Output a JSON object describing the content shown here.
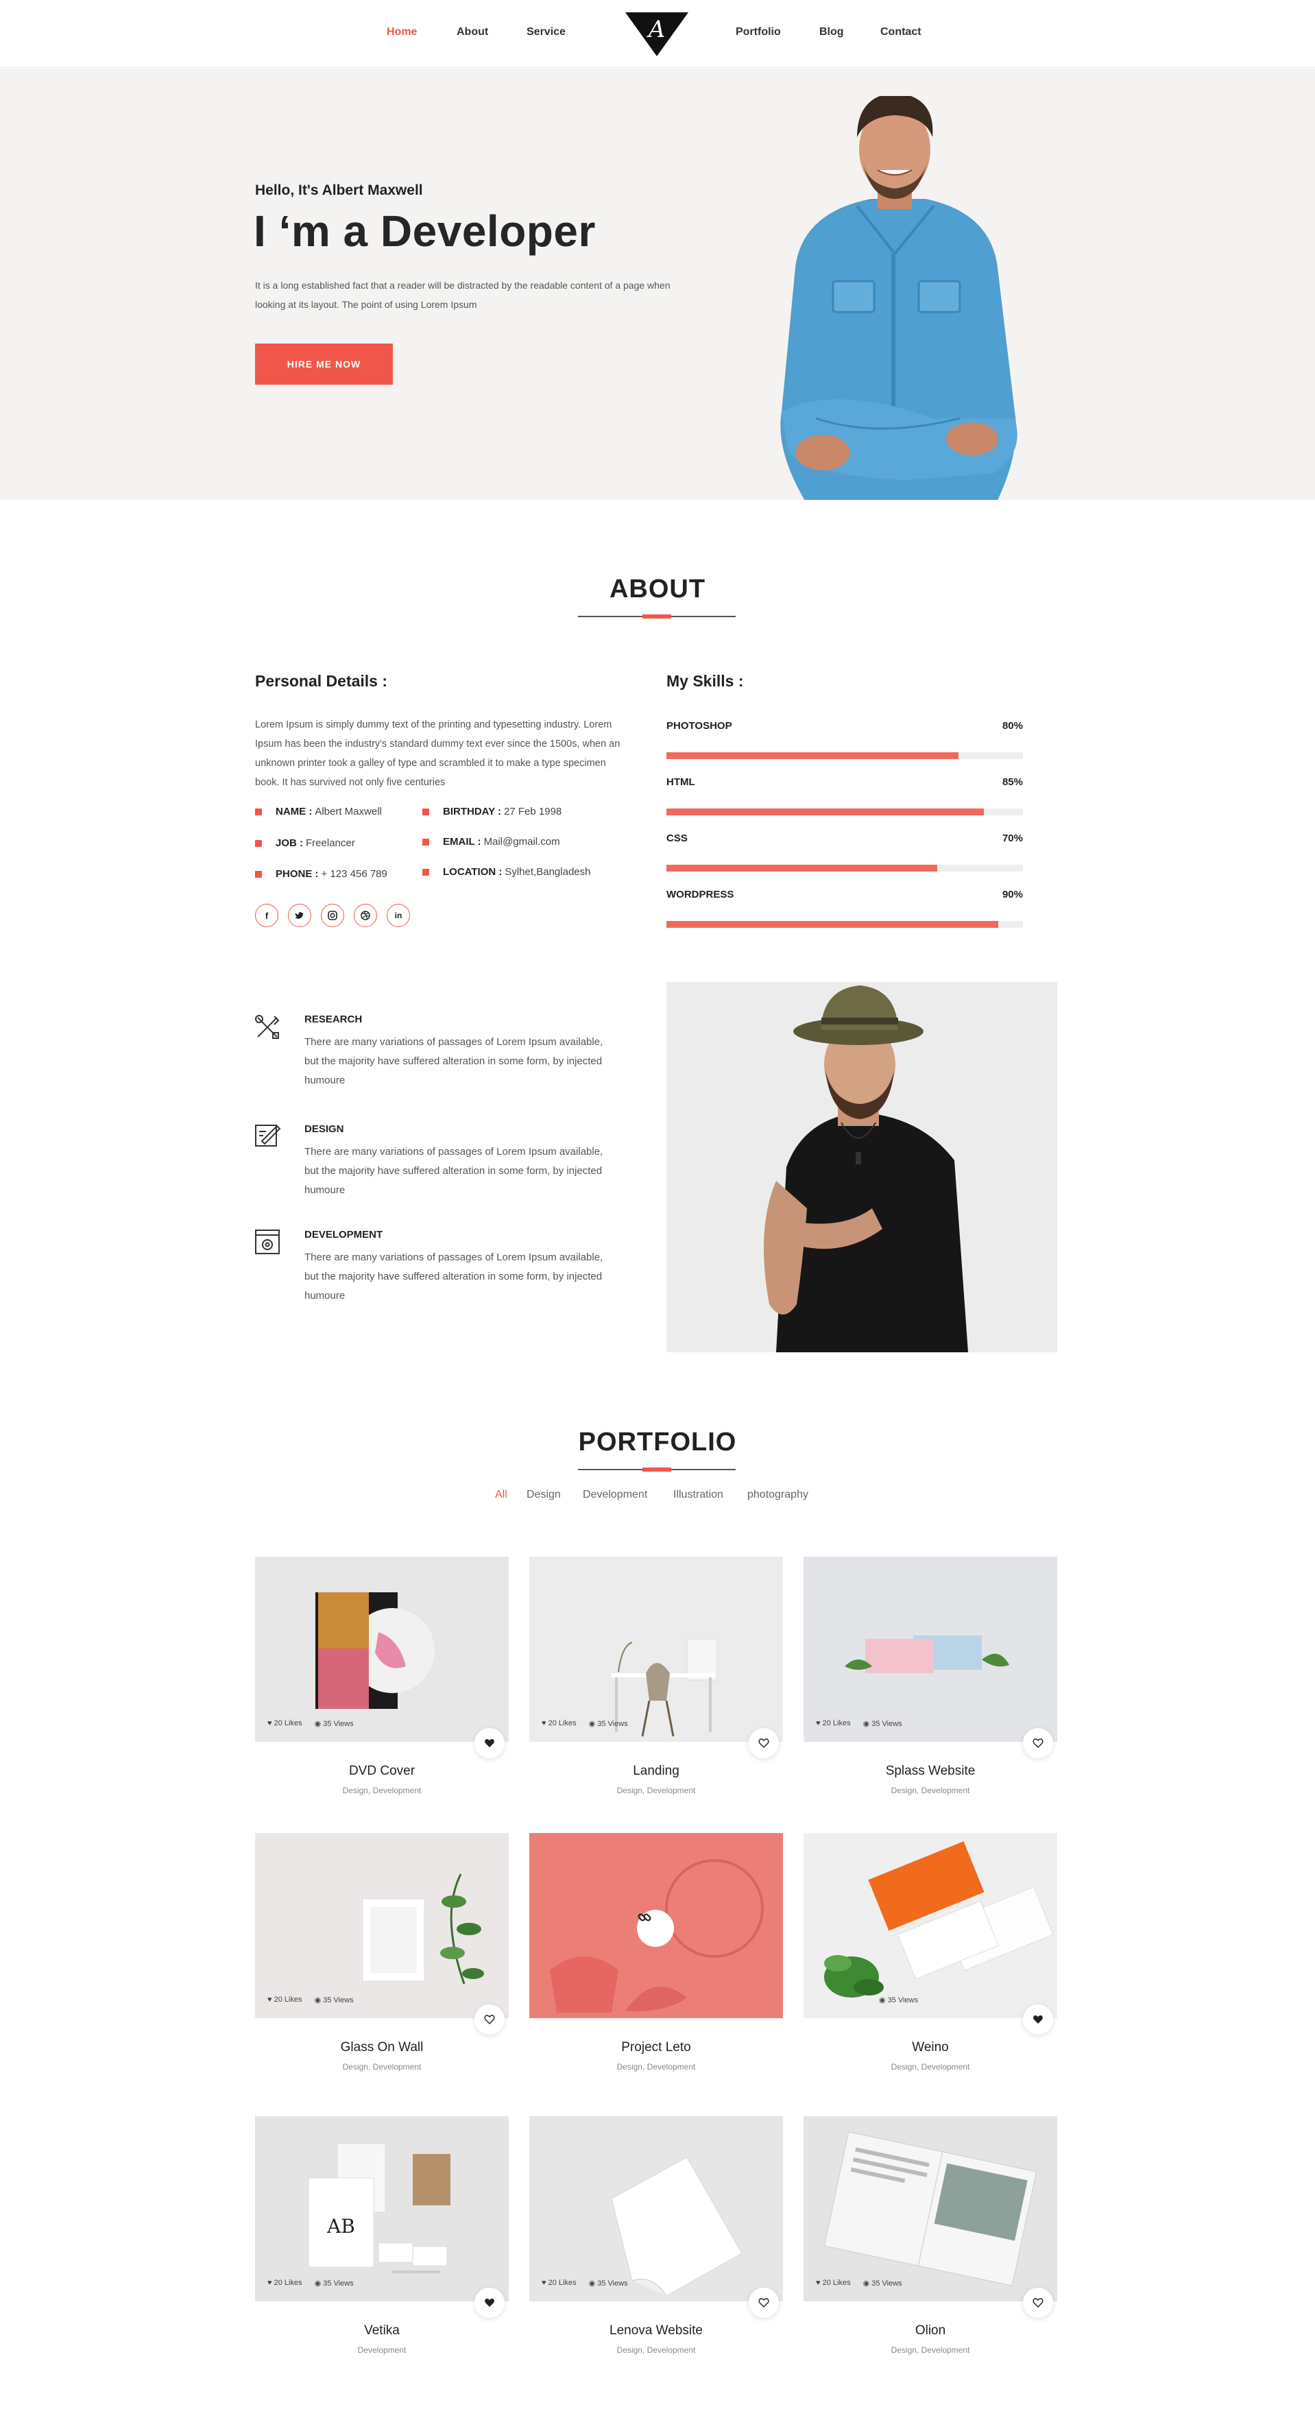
{
  "nav": {
    "left": [
      "Home",
      "About",
      "Service"
    ],
    "right": [
      "Portfolio",
      "Blog",
      "Contact"
    ],
    "logo_letter": "A"
  },
  "hero": {
    "greeting": "Hello, It's Albert Maxwell",
    "title": "I ‘m a Developer",
    "text": "It is a long established fact that a reader will be distracted by the readable content of a page when looking at its layout. The point of using Lorem Ipsum",
    "button": "HIRE ME NOW"
  },
  "about": {
    "title": "ABOUT",
    "personal_heading": "Personal Details :",
    "personal_text": "Lorem Ipsum is simply dummy text of the printing and typesetting industry. Lorem Ipsum has been the industry's standard dummy text ever since the 1500s, when an unknown printer took a galley of type and scrambled it to make a type specimen book. It has survived not only five centuries",
    "details": [
      {
        "label": "NAME :",
        "value": "Albert Maxwell"
      },
      {
        "label": "BIRTHDAY :",
        "value": "27 Feb 1998"
      },
      {
        "label": "JOB :",
        "value": "Freelancer"
      },
      {
        "label": "EMAIL :",
        "value": "Mail@gmail.com"
      },
      {
        "label": "PHONE :",
        "value": "+ 123 456 789"
      },
      {
        "label": "LOCATION :",
        "value": "Sylhet,Bangladesh"
      }
    ],
    "social": [
      "facebook-icon",
      "twitter-icon",
      "instagram-icon",
      "dribbble-icon",
      "linkedin-icon"
    ],
    "skills_heading": "My Skills :",
    "skills": [
      {
        "name": "PHOTOSHOP",
        "pct": "80%",
        "value": 0.82
      },
      {
        "name": "HTML",
        "pct": "85%",
        "value": 0.89
      },
      {
        "name": "CSS",
        "pct": "70%",
        "value": 0.76
      },
      {
        "name": "WORDPRESS",
        "pct": "90%",
        "value": 0.93
      }
    ],
    "services": [
      {
        "title": "RESEARCH",
        "icon": "research-icon",
        "text": "There are many variations of passages of Lorem Ipsum available, but the majority have suffered alteration in some form, by injected humoure"
      },
      {
        "title": "DESIGN",
        "icon": "design-icon",
        "text": "There are many variations of passages of Lorem Ipsum available, but the majority have suffered alteration in some form, by injected humoure"
      },
      {
        "title": "DEVELOPMENT",
        "icon": "development-icon",
        "text": "There are many variations of passages of Lorem Ipsum available, but the majority have suffered alteration in some form, by injected humoure"
      }
    ]
  },
  "portfolio": {
    "title": "PORTFOLIO",
    "filters": [
      "All",
      "Design",
      "Development",
      "Illustration",
      "photography"
    ],
    "items": [
      {
        "name": "DVD Cover",
        "category": "Design, Development",
        "likes": "20 Likes",
        "views": "35 Views"
      },
      {
        "name": "Landing",
        "category": "Design, Development",
        "likes": "20 Likes",
        "views": "35 Views"
      },
      {
        "name": "Splass Website",
        "category": "Design, Development",
        "likes": "20 Likes",
        "views": "35 Views"
      },
      {
        "name": "Glass On Wall",
        "category": "Design, Development",
        "likes": "20 Likes",
        "views": "35 Views"
      },
      {
        "name": "Project Leto",
        "category": "Design, Development",
        "likes": "",
        "views": ""
      },
      {
        "name": "Weino",
        "category": "Design, Development",
        "likes": "",
        "views": "35 Views"
      },
      {
        "name": "Vetika",
        "category": "Development",
        "likes": "20 Likes",
        "views": "35 Views"
      },
      {
        "name": "Lenova Website",
        "category": "Design, Development",
        "likes": "20 Likes",
        "views": "35 Views"
      },
      {
        "name": "Olion",
        "category": "Design, Development",
        "likes": "20 Likes",
        "views": "35 Views"
      }
    ]
  },
  "colors": {
    "accent": "#f1564a",
    "hero_bg": "#f4f3f1"
  }
}
